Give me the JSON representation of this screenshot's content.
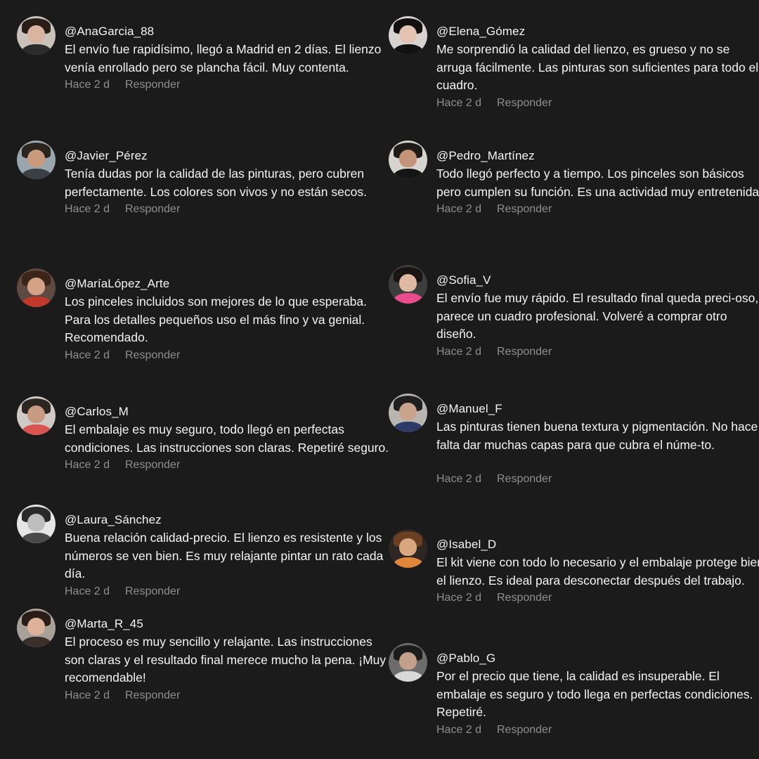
{
  "colors": {
    "background": "#1b1b1b",
    "text": "#f4f4f4",
    "meta": "#8e8e8e"
  },
  "comments": [
    {
      "username": "@AnaGarcia_88",
      "text": "El envío fue rapidísimo, llegó a Madrid en 2 días. El lienzo venía enrollado pero se plancha fácil. Muy contenta.",
      "time": "Hace 2 d",
      "reply": "Responder",
      "avatar": {
        "skin": "#d9b59f",
        "hair": "#2a1d17",
        "bg": "#c9c2bb",
        "shirt": "#2b2b2b"
      }
    },
    {
      "username": "@Elena_Gómez",
      "text": "Me sorprendió la calidad del lienzo, es grueso y no se arruga fácilmente. Las pinturas son suficientes para todo el cuadro.",
      "time": "Hace 2 d",
      "reply": "Responder",
      "avatar": {
        "skin": "#e2c2b0",
        "hair": "#101010",
        "bg": "#d8d3d0",
        "shirt": "#111111"
      }
    },
    {
      "username": "@Javier_Pérez",
      "text": "Tenía dudas por la calidad de las pinturas, pero cubren perfectamente. Los colores son vivos y no están secos.",
      "time": "Hace 2 d",
      "reply": "Responder",
      "avatar": {
        "skin": "#c99b7e",
        "hair": "#2b231e",
        "bg": "#9aa5ad",
        "shirt": "#3a3f45"
      }
    },
    {
      "username": "@Pedro_Martínez",
      "text": "Todo llegó perfecto y a tiempo. Los pinceles son básicos pero cumplen su función. Es una actividad muy entretenida.",
      "time": "Hace 2 d",
      "reply": "Responder",
      "avatar": {
        "skin": "#c49478",
        "hair": "#1e1a17",
        "bg": "#d7d4cf",
        "shirt": "#151515"
      }
    },
    {
      "username": "@MaríaLópez_Arte",
      "text": "Los pinceles incluidos son mejores de lo que esperaba. Para los detalles pequeños uso el más fino y va genial. Recomendado.",
      "time": "Hace 2 d",
      "reply": "Responder",
      "avatar": {
        "skin": "#d4a387",
        "hair": "#3b2418",
        "bg": "#5e4a40",
        "shirt": "#c0392b"
      }
    },
    {
      "username": "@Sofia_V",
      "text": "El envío fue muy rápido. El resultado final queda preci-oso, parece un cuadro profesional. Volveré a comprar otro diseño.",
      "time": "Hace 2 d",
      "reply": "Responder",
      "avatar": {
        "skin": "#e0b9a3",
        "hair": "#1a1412",
        "bg": "#3d3d3d",
        "shirt": "#e84c8b"
      }
    },
    {
      "username": "@Carlos_M",
      "text": "El embalaje es muy seguro, todo llegó en perfectas condiciones. Las instrucciones son claras. Repetiré seguro.",
      "time": "Hace 2 d",
      "reply": "Responder",
      "avatar": {
        "skin": "#c99a82",
        "hair": "#2d2520",
        "bg": "#cfcac6",
        "shirt": "#d9534f"
      }
    },
    {
      "username": "@Manuel_F",
      "text": "Las pinturas tienen buena textura y pigmentación. No hace falta dar muchas capas para que cubra el núme-to.",
      "time": "Hace 2 d",
      "reply": "Responder",
      "avatar": {
        "skin": "#c9a38b",
        "hair": "#1f1f1f",
        "bg": "#b9b6b2",
        "shirt": "#2b3a66"
      }
    },
    {
      "username": "@Laura_Sánchez",
      "text": "Buena relación calidad-precio. El lienzo es resistente y los números se ven bien. Es muy relajante pintar un rato cada día.",
      "time": "Hace 2 d",
      "reply": "Responder",
      "avatar": {
        "skin": "#bdbdbd",
        "hair": "#2a2a2a",
        "bg": "#e6e6e6",
        "shirt": "#4a4a4a"
      }
    },
    {
      "username": "@Isabel_D",
      "text": "El kit viene con todo lo necesario y el embalaje protege bien el lienzo. Es ideal para desconectar después del trabajo.",
      "time": "Hace 2 d",
      "reply": "Responder",
      "avatar": {
        "skin": "#d8a77f",
        "hair": "#6b3f22",
        "bg": "#2e2622",
        "shirt": "#e0883a"
      }
    },
    {
      "username": "@Marta_R_45",
      "text": "El proceso es muy sencillo y relajante. Las instrucciones son claras y el resultado final merece mucho la pena. ¡Muy recomendable!",
      "time": "Hace 2 d",
      "reply": "Responder",
      "avatar": {
        "skin": "#dcb39a",
        "hair": "#2a1c16",
        "bg": "#a8a19a",
        "shirt": "#3a2f2a"
      }
    },
    {
      "username": "@Pablo_G",
      "text": "Por el precio que tiene, la calidad es insuperable. El embalaje es seguro y todo llega en perfectas condiciones. Repetiré.",
      "time": "Hace 2 d",
      "reply": "Responder",
      "avatar": {
        "skin": "#c2a08c",
        "hair": "#1c1c1c",
        "bg": "#6c6c6c",
        "shirt": "#d8d8d8"
      }
    }
  ]
}
